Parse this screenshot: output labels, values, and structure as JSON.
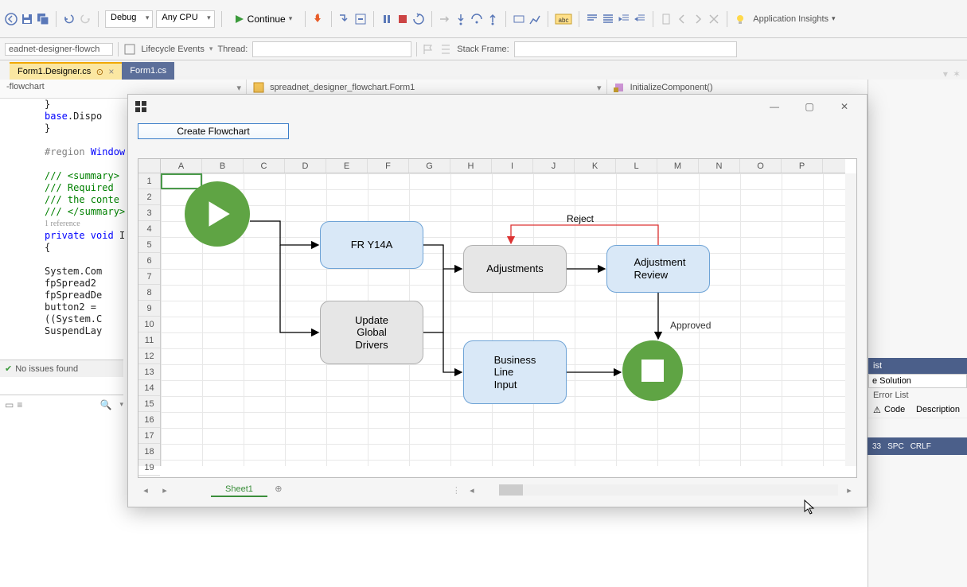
{
  "toolbar": {
    "config": "Debug",
    "platform": "Any CPU",
    "continue_label": "Continue",
    "app_insights": "Application Insights"
  },
  "subtoolbar": {
    "process_label": "eadnet-designer-flowch",
    "lifecycle_label": "Lifecycle Events",
    "thread_label": "Thread:",
    "stackframe_label": "Stack Frame:"
  },
  "tabs": {
    "active": "Form1.Designer.cs",
    "other": "Form1.cs"
  },
  "nav": {
    "scope": "-flowchart",
    "type": "spreadnet_designer_flowchart.Form1",
    "member": "InitializeComponent()"
  },
  "code": {
    "l1": "        }",
    "l2": "        base.Dispo",
    "l3": "    }",
    "l4": "",
    "l5": "    #region Window",
    "l6": "",
    "l7": "    /// <summary>",
    "l8": "    ///  Required ",
    "l9": "    ///  the conte",
    "l10": "    /// </summary>",
    "l11": "    1 reference",
    "l12": "    private void I",
    "l13": "    {",
    "l14": "",
    "l15": "        System.Com",
    "l16": "        fpSpread2 ",
    "l17": "        fpSpreadDe",
    "l18": "        button2 = ",
    "l19": "        ((System.C",
    "l20": "        SuspendLay"
  },
  "status": {
    "no_issues": "No issues found"
  },
  "appwin": {
    "create_btn": "Create Flowchart",
    "sheet_tab": "Sheet1",
    "cols": [
      "A",
      "B",
      "C",
      "D",
      "E",
      "F",
      "G",
      "H",
      "I",
      "J",
      "K",
      "L",
      "M",
      "N",
      "O",
      "P"
    ],
    "rows": [
      "1",
      "2",
      "3",
      "4",
      "5",
      "6",
      "7",
      "8",
      "9",
      "10",
      "11",
      "12",
      "13",
      "14",
      "15",
      "16",
      "17",
      "18",
      "19"
    ]
  },
  "flowchart": {
    "fr": "FR Y14A",
    "upd": "Update\nGlobal\nDrivers",
    "adj": "Adjustments",
    "rev": "Adjustment\nReview",
    "bli": "Business\nLine\nInput",
    "reject": "Reject",
    "approved": "Approved"
  },
  "right": {
    "list_hdr": "ist",
    "solution": "e Solution",
    "error_list": "Error List",
    "code_col": "Code",
    "desc_col": "Description"
  },
  "status_right": {
    "col1": "33",
    "col2": "SPC",
    "col3": "CRLF"
  }
}
